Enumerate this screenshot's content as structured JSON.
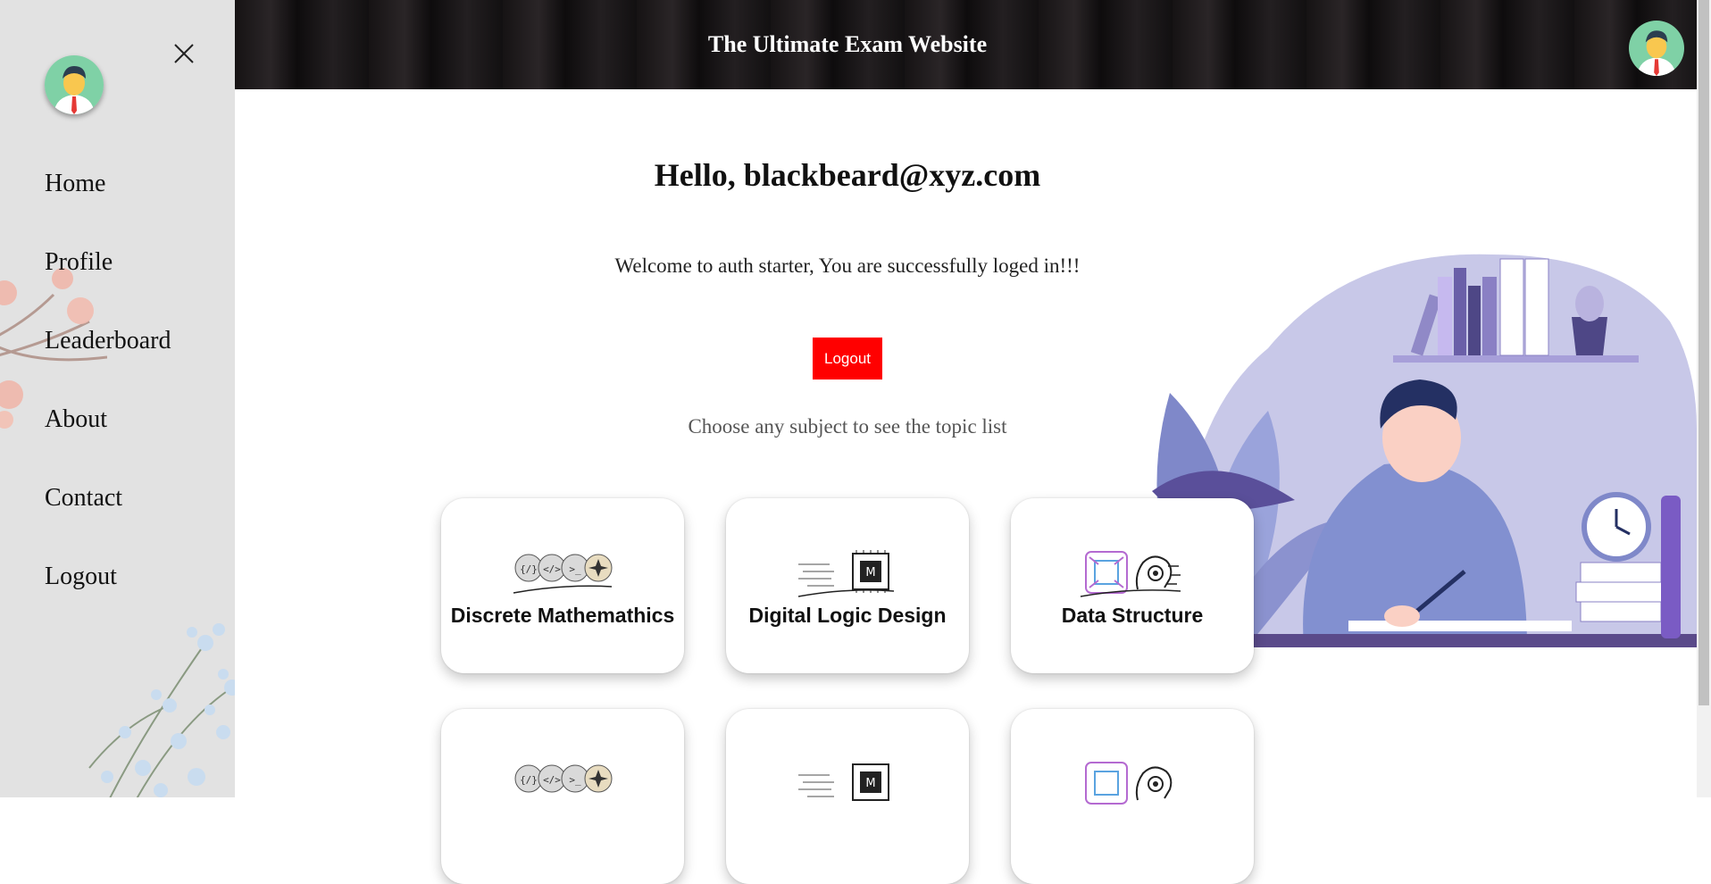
{
  "header": {
    "title": "The Ultimate Exam Website"
  },
  "sidebar": {
    "items": [
      {
        "label": "Home"
      },
      {
        "label": "Profile"
      },
      {
        "label": "Leaderboard"
      },
      {
        "label": "About"
      },
      {
        "label": "Contact"
      },
      {
        "label": "Logout"
      }
    ]
  },
  "main": {
    "greeting": "Hello, blackbeard@xyz.com",
    "welcome": "Welcome to auth starter, You are successfully loged in!!!",
    "logout_label": "Logout",
    "choose_prompt": "Choose any subject to see the topic list",
    "cards": [
      {
        "label": "Discrete Mathemathics",
        "icon": "code-symbols-icon"
      },
      {
        "label": "Digital Logic Design",
        "icon": "circuit-chip-icon"
      },
      {
        "label": "Data Structure",
        "icon": "ai-brain-icon"
      },
      {
        "label": "",
        "icon": "code-symbols-icon"
      },
      {
        "label": "",
        "icon": "circuit-chip-icon"
      },
      {
        "label": "",
        "icon": "ai-brain-icon"
      }
    ]
  },
  "colors": {
    "accent_red": "#ff0000",
    "sidebar_bg": "#e2e2e2",
    "hero_purple": "#6c63b5"
  }
}
